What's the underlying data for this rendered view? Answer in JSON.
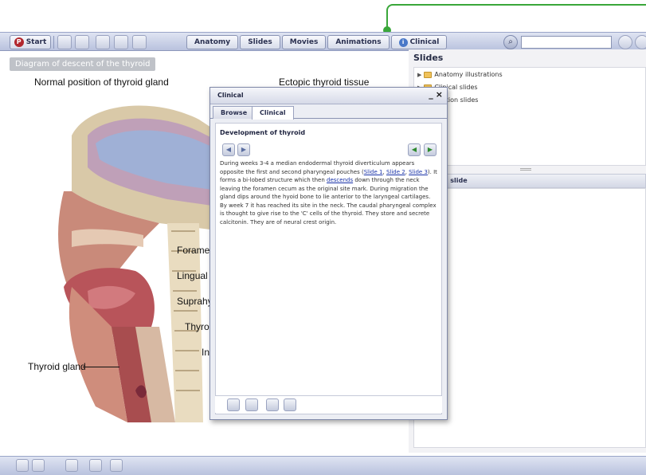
{
  "toolbar": {
    "start_label": "Start",
    "tabs": [
      {
        "label": "Anatomy"
      },
      {
        "label": "Slides"
      },
      {
        "label": "Movies"
      },
      {
        "label": "Animations"
      },
      {
        "label": "Clinical"
      }
    ],
    "search_value": ""
  },
  "diagram": {
    "caption": "Diagram of descent of the thyroid",
    "heading_left": "Normal position of thyroid gland",
    "heading_right": "Ectopic thyroid tissue",
    "labels": {
      "thyroid_gland": "Thyroid gland",
      "foramen": "Foramen",
      "lingual": "Lingual t",
      "suprahyoid": "Suprahy",
      "thyroglossal": "Thyrog",
      "infrahyoid": "In"
    }
  },
  "slides_panel": {
    "title": "Slides",
    "tree": [
      {
        "label": "Anatomy illustrations"
      },
      {
        "label": "Clinical slides"
      },
      {
        "label": "Section slides"
      }
    ],
    "in_slide_title": "in slide"
  },
  "popup": {
    "title": "Clinical",
    "minimize": "_",
    "close": "×",
    "tabs": [
      {
        "label": "Browse"
      },
      {
        "label": "Clinical"
      }
    ],
    "section_title": "Development of thyroid",
    "text": {
      "part1": "During weeks 3-4 a median endodermal thyroid diverticulum appears opposite the first and second pharyngeal pouches (",
      "link_slide1": "Slide 1",
      "sep1": ", ",
      "link_slide2": "Slide 2",
      "sep2": ", ",
      "link_slide3": "Slide 3",
      "part2": "). It forms a bi-lobed structure which then ",
      "link_descends": "descends",
      "part3": " down through the neck leaving the foramen cecum as the original site mark. During migration the gland dips around the hyoid bone to lie anterior to the laryngeal cartilages. By week 7 it has reached its site in the neck. The caudal pharyngeal complex is thought to give rise to the 'C' cells of the thyroid. They store and secrete calcitonin. They are of neural crest origin."
    }
  },
  "colors": {
    "callout_green": "#3aa73a",
    "toolbar_blue": "#b9c2de",
    "link_blue": "#1a33a8"
  }
}
